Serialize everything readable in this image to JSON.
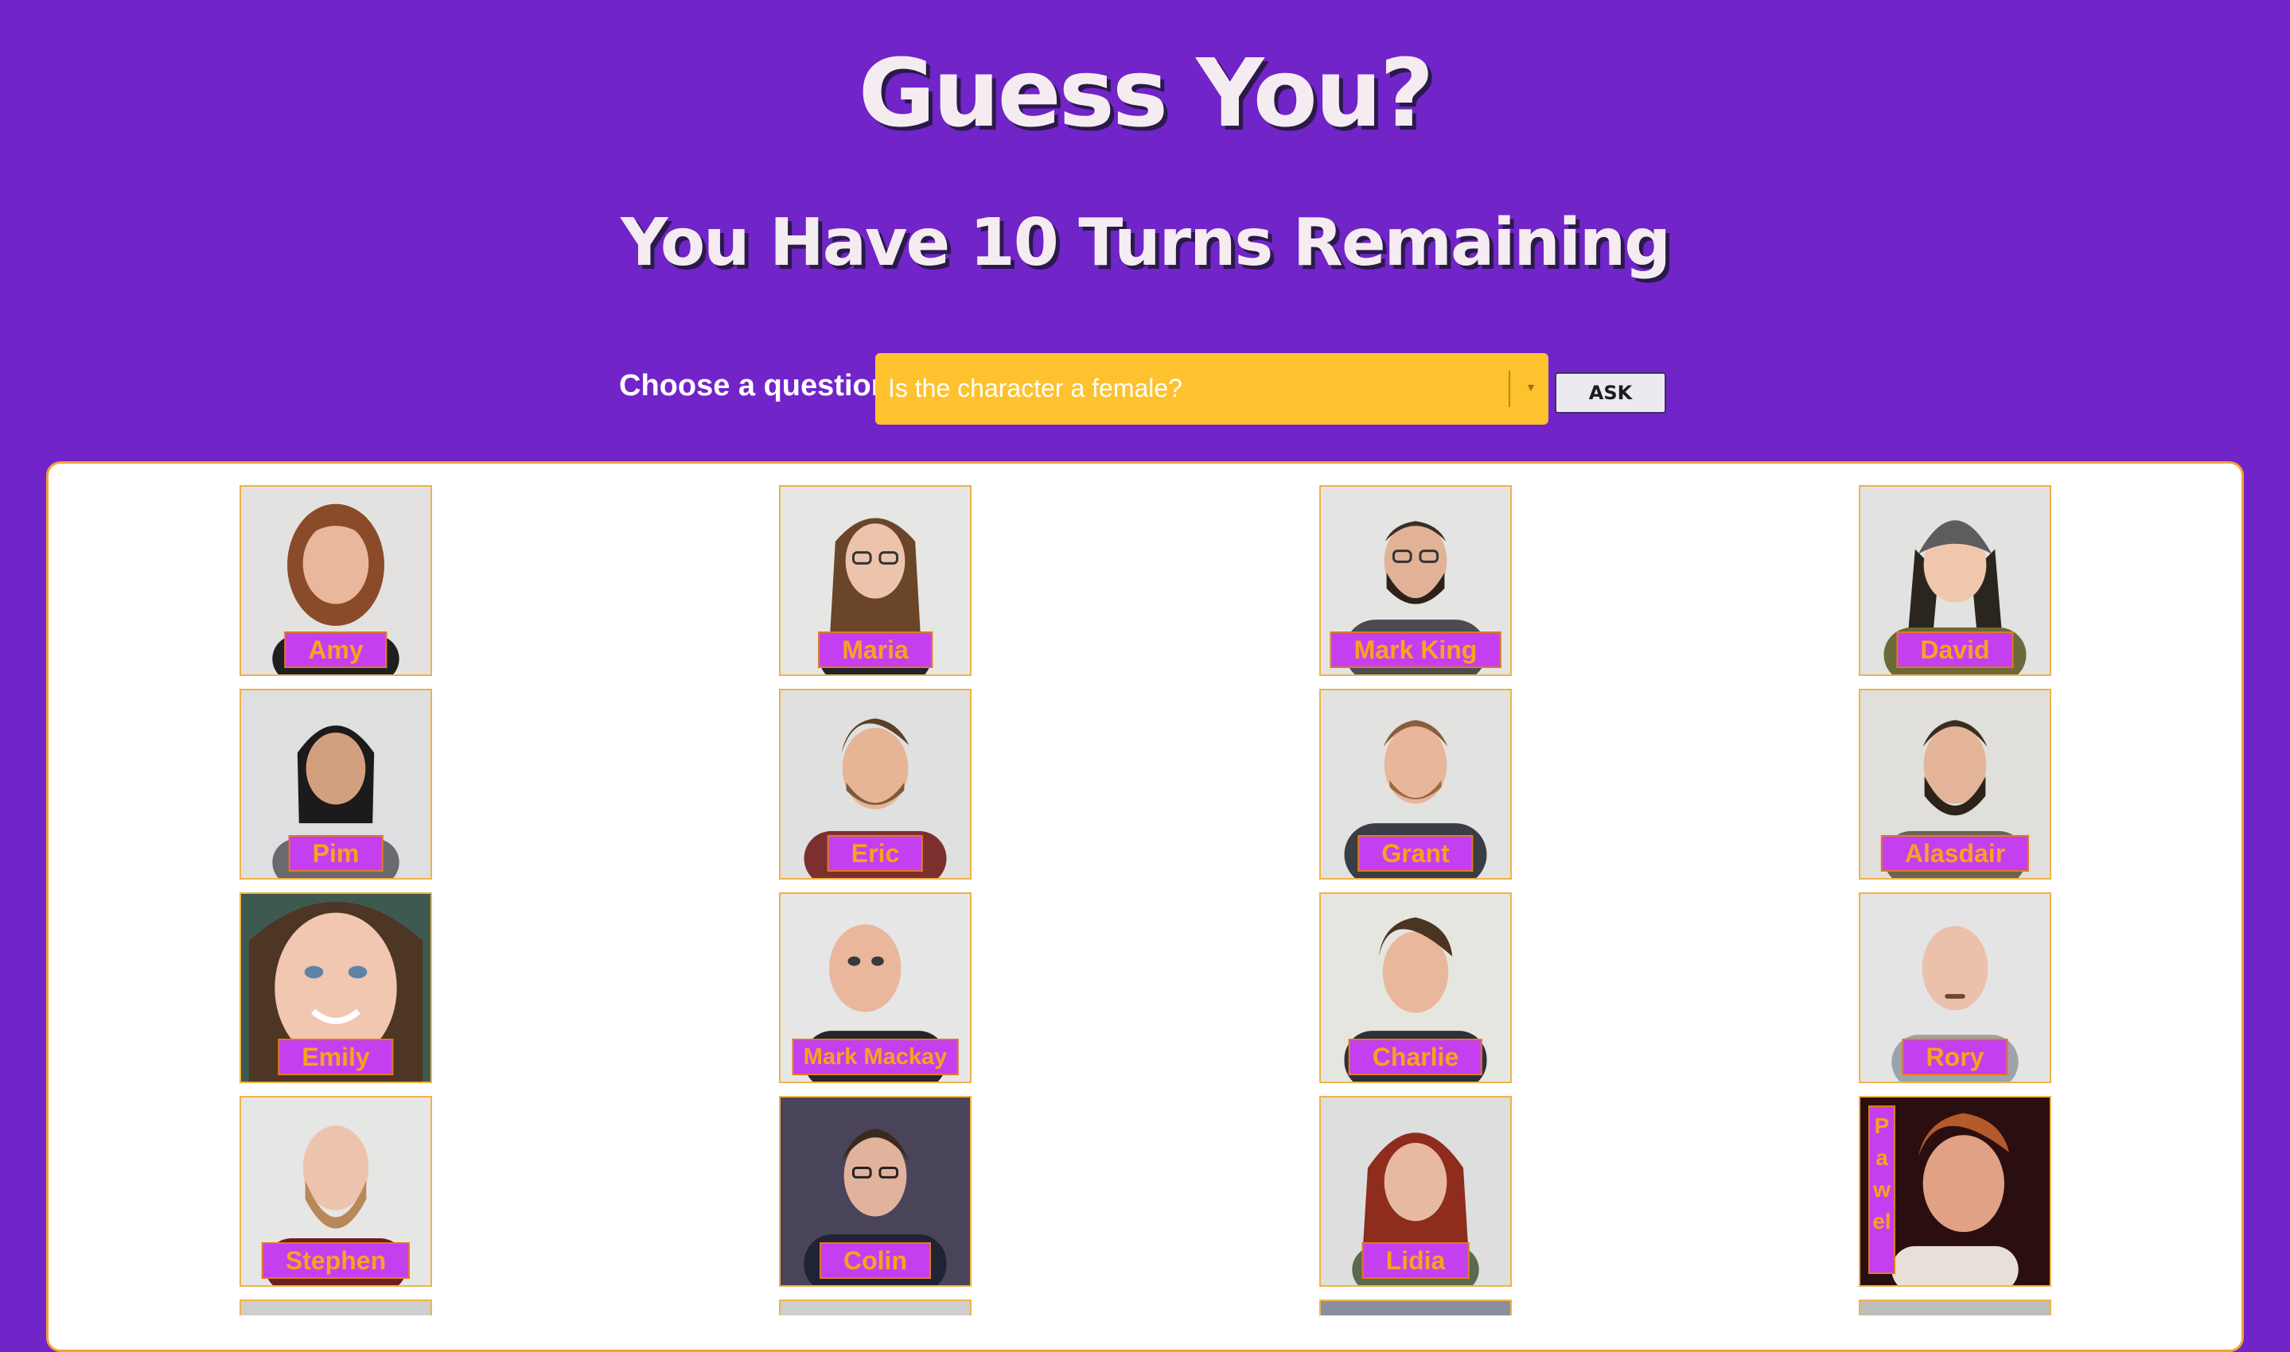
{
  "header": {
    "title": "Guess You?",
    "turns_text": "You Have 10 Turns Remaining"
  },
  "question": {
    "label": "Choose a question",
    "selected": "Is the character a female?",
    "ask_label": "ASK"
  },
  "colors": {
    "background": "#7124c8",
    "select": "#fdc22d",
    "name_tag_bg": "#c43ff0",
    "name_tag_text": "#f8a21d",
    "card_border": "#f0b347"
  },
  "characters": [
    {
      "name": "Amy"
    },
    {
      "name": "Maria"
    },
    {
      "name": "Mark King"
    },
    {
      "name": "David"
    },
    {
      "name": "Pim"
    },
    {
      "name": "Eric"
    },
    {
      "name": "Grant"
    },
    {
      "name": "Alasdair"
    },
    {
      "name": "Emily"
    },
    {
      "name": "Mark Mackay"
    },
    {
      "name": "Charlie"
    },
    {
      "name": "Rory"
    },
    {
      "name": "Stephen"
    },
    {
      "name": "Colin"
    },
    {
      "name": "Lidia"
    },
    {
      "name": "Pawel"
    }
  ]
}
